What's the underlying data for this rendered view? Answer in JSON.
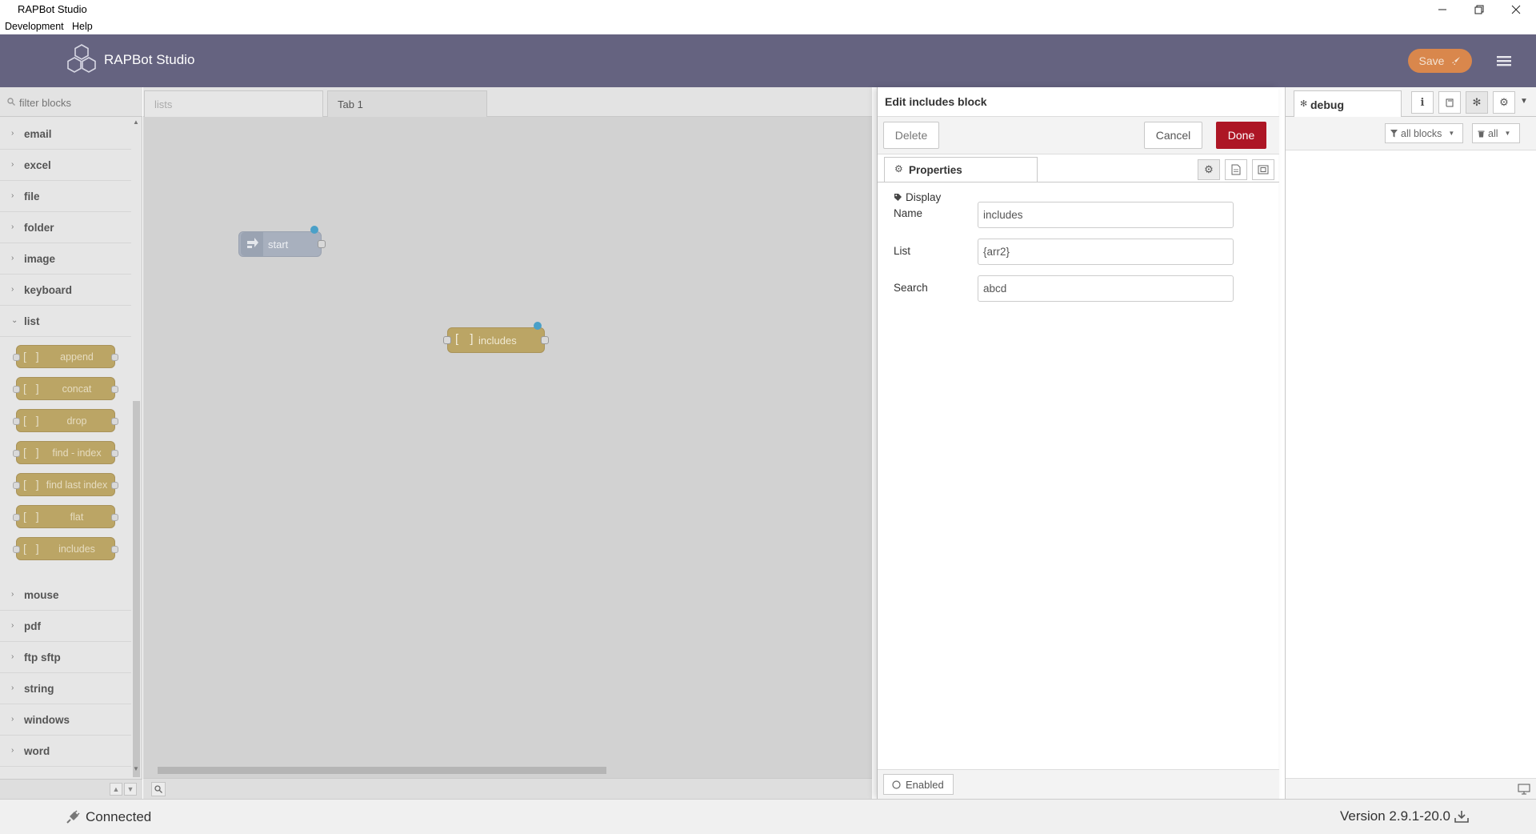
{
  "window": {
    "title": "RAPBot Studio"
  },
  "menubar": {
    "items": [
      "Development",
      "Help"
    ]
  },
  "header": {
    "title": "RAPBot Studio",
    "save_label": "Save"
  },
  "palette": {
    "filter_placeholder": "filter blocks",
    "categories_top": [
      "email",
      "excel",
      "file",
      "folder",
      "image",
      "keyboard"
    ],
    "open_category": "list",
    "list_nodes": [
      "append",
      "concat",
      "drop",
      "find - index",
      "find last index",
      "flat",
      "includes"
    ],
    "categories_bottom": [
      "mouse",
      "pdf",
      "ftp sftp",
      "string",
      "windows",
      "word"
    ]
  },
  "workspace": {
    "tabs": [
      {
        "label": "lists",
        "active": false
      },
      {
        "label": "Tab 1",
        "active": true
      }
    ],
    "nodes": [
      {
        "label": "start",
        "color": "#a8b0be"
      },
      {
        "label": "includes",
        "color": "#bba565"
      }
    ]
  },
  "tray": {
    "title": "Edit includes block",
    "delete_label": "Delete",
    "cancel_label": "Cancel",
    "done_label": "Done",
    "properties_tab": "Properties",
    "fields": {
      "name_label_1": "Display",
      "name_label_2": "Name",
      "name_value": "includes",
      "list_label": "List",
      "list_value": "{arr2}",
      "search_label": "Search",
      "search_value": "abcd"
    },
    "enabled_label": "Enabled"
  },
  "sidebar": {
    "tab_label": "debug",
    "filter_label": "all blocks",
    "clear_label": "all"
  },
  "statusbar": {
    "connection": "Connected",
    "version": "Version 2.9.1-20.0"
  },
  "colors": {
    "header": "#656380",
    "save": "#d9874c",
    "done": "#ad1625",
    "node": "#bba565",
    "canvas": "#d2d2d2"
  }
}
